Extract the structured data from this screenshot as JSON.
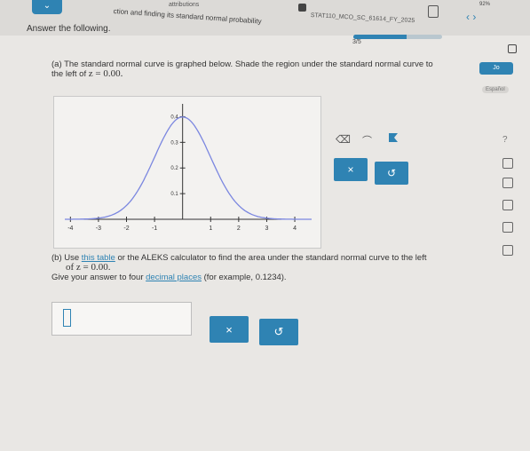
{
  "header": {
    "topic_small": "attributions",
    "topic": "ction and finding its standard normal probability",
    "course": "STAT110_MCO_SC_61614_FY_2025",
    "progress": "3/5",
    "progress_fraction": 0.6,
    "status": "92%"
  },
  "side": {
    "language": "Jo",
    "espanol": "Español"
  },
  "question": {
    "instruction": "Answer the following.",
    "part_a_prefix": "(a) The standard normal curve is graphed below. Shade the region under the standard normal curve to",
    "part_a_suffix": "the left of",
    "z_value": "z = 0.00.",
    "part_b_line1_start": "(b) Use",
    "part_b_link": "this table",
    "part_b_line1_end": "or the ALEKS calculator to find the area under the standard normal curve to the left",
    "part_b_line2": "of z = 0.00.",
    "part_b_line3_start": "Give your answer to four",
    "part_b_link2": "decimal places",
    "part_b_line3_end": "(for example, 0.1234)."
  },
  "chart_data": {
    "type": "line",
    "x_ticks": [
      "-4",
      "-3",
      "-2",
      "-1",
      "1",
      "2",
      "3",
      "4"
    ],
    "y_ticks": [
      "0.1",
      "0.2",
      "0.3",
      "0.4"
    ],
    "xlim": [
      -4.2,
      4.6
    ],
    "ylim": [
      0,
      0.45
    ]
  },
  "buttons": {
    "clear_symbol": "×",
    "undo_symbol": "↺"
  },
  "colors": {
    "accent": "#2f83b3",
    "curve": "#7b87e0"
  }
}
